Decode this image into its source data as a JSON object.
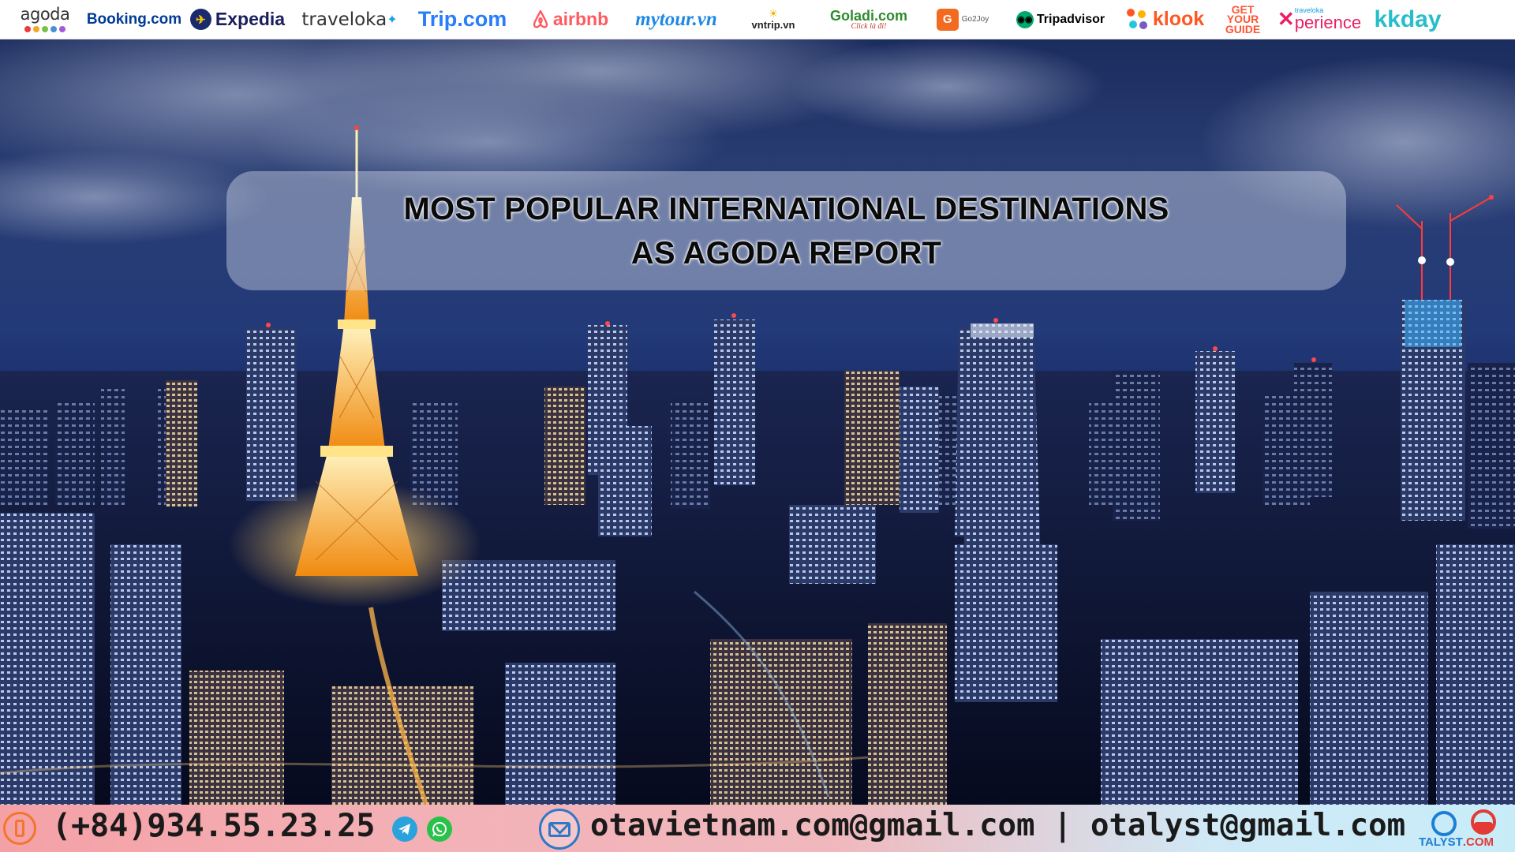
{
  "partner_logos": {
    "agoda": "agoda",
    "booking": "Booking.com",
    "expedia": "Expedia",
    "traveloka": "traveloka",
    "trip": "Trip.com",
    "airbnb": "airbnb",
    "mytour": "mytour.vn",
    "vntrip": "vntrip.vn",
    "goladi": "Goladi.com",
    "goladi_tagline": "Click là đi!",
    "go2joy_badge": "G",
    "go2joy": "Go2Joy",
    "tripadvisor": "Tripadvisor",
    "klook": "klook",
    "getyourguide": [
      "GET",
      "YOUR",
      "GUIDE"
    ],
    "xperience_small": "traveloka",
    "xperience": "perience",
    "kkday": "kkday"
  },
  "banner": {
    "title_line1": "MOST POPULAR INTERNATIONAL DESTINATIONS",
    "title_line2": "AS AGODA REPORT"
  },
  "contact": {
    "phone": "(+84)934.55.23.25",
    "email": "otavietnam.com@gmail.com | otalyst@gmail.com",
    "brand_prefix": "TALYST",
    "brand_suffix": ".COM"
  },
  "colors": {
    "agoda_dots": [
      "#e83b3b",
      "#f5a623",
      "#7ac142",
      "#4a90d9",
      "#a25bd8"
    ],
    "accent_orange": "#f2762c",
    "accent_blue": "#2e78c8"
  }
}
